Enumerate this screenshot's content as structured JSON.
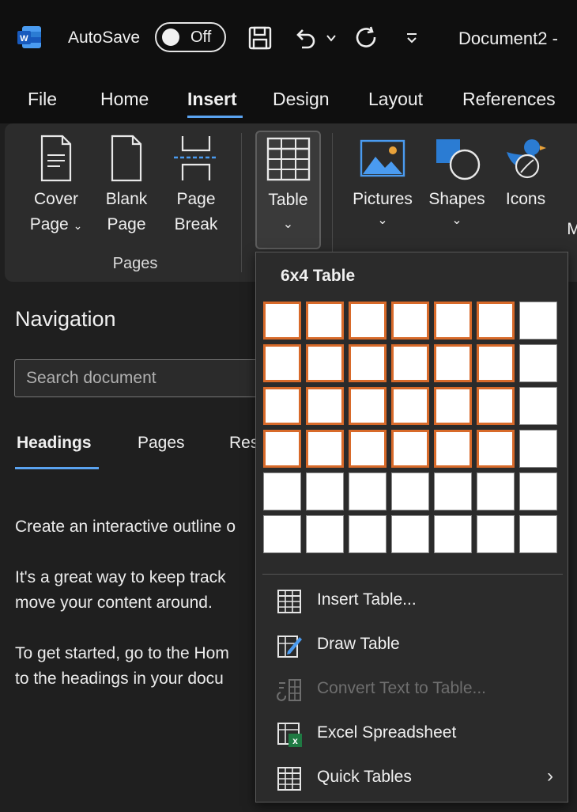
{
  "titlebar": {
    "autosave_label": "AutoSave",
    "autosave_state": "Off",
    "document_title": "Document2 -"
  },
  "tabs": [
    "File",
    "Home",
    "Insert",
    "Design",
    "Layout",
    "References"
  ],
  "active_tab": "Insert",
  "ribbon": {
    "cover_page": [
      "Cover",
      "Page"
    ],
    "blank_page": [
      "Blank",
      "Page"
    ],
    "page_break": [
      "Page",
      "Break"
    ],
    "pages_group": "Pages",
    "table": "Table",
    "pictures": "Pictures",
    "shapes": "Shapes",
    "icons": "Icons",
    "cut_off": "M"
  },
  "navigation": {
    "title": "Navigation",
    "search_placeholder": "Search document",
    "tabs": [
      "Headings",
      "Pages",
      "Res"
    ],
    "line1": "Create an interactive outline o",
    "line2": "It's a great way to keep track",
    "line3": "move your content around.",
    "line4": "To get started, go to the Hom",
    "line5": "to the headings in your docu"
  },
  "table_menu": {
    "header": "6x4 Table",
    "grid_cols": 7,
    "grid_rows": 6,
    "selected_cols": 6,
    "selected_rows": 4,
    "items": [
      {
        "label": "Insert Table...",
        "icon": "table-grid-icon",
        "disabled": false
      },
      {
        "label": "Draw Table",
        "icon": "draw-table-icon",
        "disabled": false
      },
      {
        "label": "Convert Text to Table...",
        "icon": "convert-text-icon",
        "disabled": true
      },
      {
        "label": "Excel Spreadsheet",
        "icon": "excel-icon",
        "disabled": false
      },
      {
        "label": "Quick Tables",
        "icon": "quick-tables-icon",
        "disabled": false,
        "submenu": true
      }
    ]
  },
  "colors": {
    "accent": "#5aa3f0",
    "grid_selected_border": "#d86a2a",
    "word_blue": "#2b7cd3"
  }
}
